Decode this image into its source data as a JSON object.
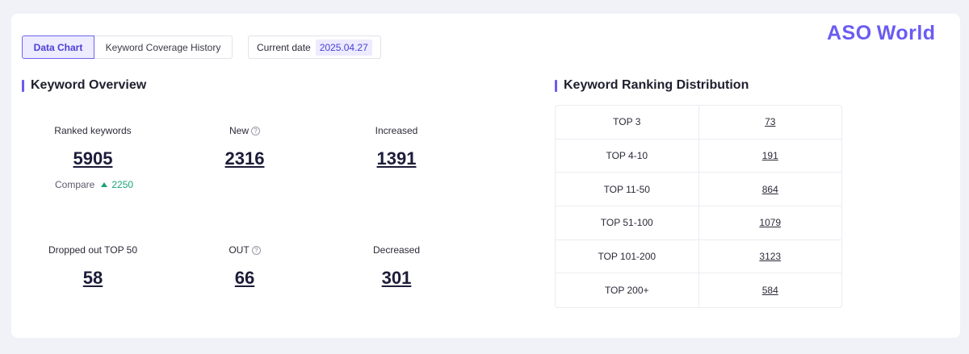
{
  "tabs": [
    {
      "label": "Data Chart",
      "active": true
    },
    {
      "label": "Keyword Coverage History",
      "active": false
    }
  ],
  "current_date": {
    "label": "Current date",
    "value": "2025.04.27"
  },
  "logo": {
    "left": "ASO",
    "right": "World",
    "accent": "#6a5cf2",
    "dot": "#f6b11c"
  },
  "overview": {
    "title": "Keyword Overview",
    "stats": {
      "ranked": {
        "label": "Ranked keywords",
        "value": "5905"
      },
      "new": {
        "label": "New",
        "value": "2316"
      },
      "increased": {
        "label": "Increased",
        "value": "1391"
      },
      "dropped": {
        "label": "Dropped out TOP 50",
        "value": "58"
      },
      "out": {
        "label": "OUT",
        "value": "66"
      },
      "decreased": {
        "label": "Decreased",
        "value": "301"
      }
    },
    "compare": {
      "label": "Compare",
      "value": "2250",
      "direction": "up"
    }
  },
  "ranking": {
    "title": "Keyword Ranking Distribution",
    "rows": [
      {
        "range": "TOP 3",
        "count": "73"
      },
      {
        "range": "TOP 4-10",
        "count": "191"
      },
      {
        "range": "TOP 11-50",
        "count": "864"
      },
      {
        "range": "TOP 51-100",
        "count": "1079"
      },
      {
        "range": "TOP 101-200",
        "count": "3123"
      },
      {
        "range": "TOP 200+",
        "count": "584"
      }
    ]
  }
}
